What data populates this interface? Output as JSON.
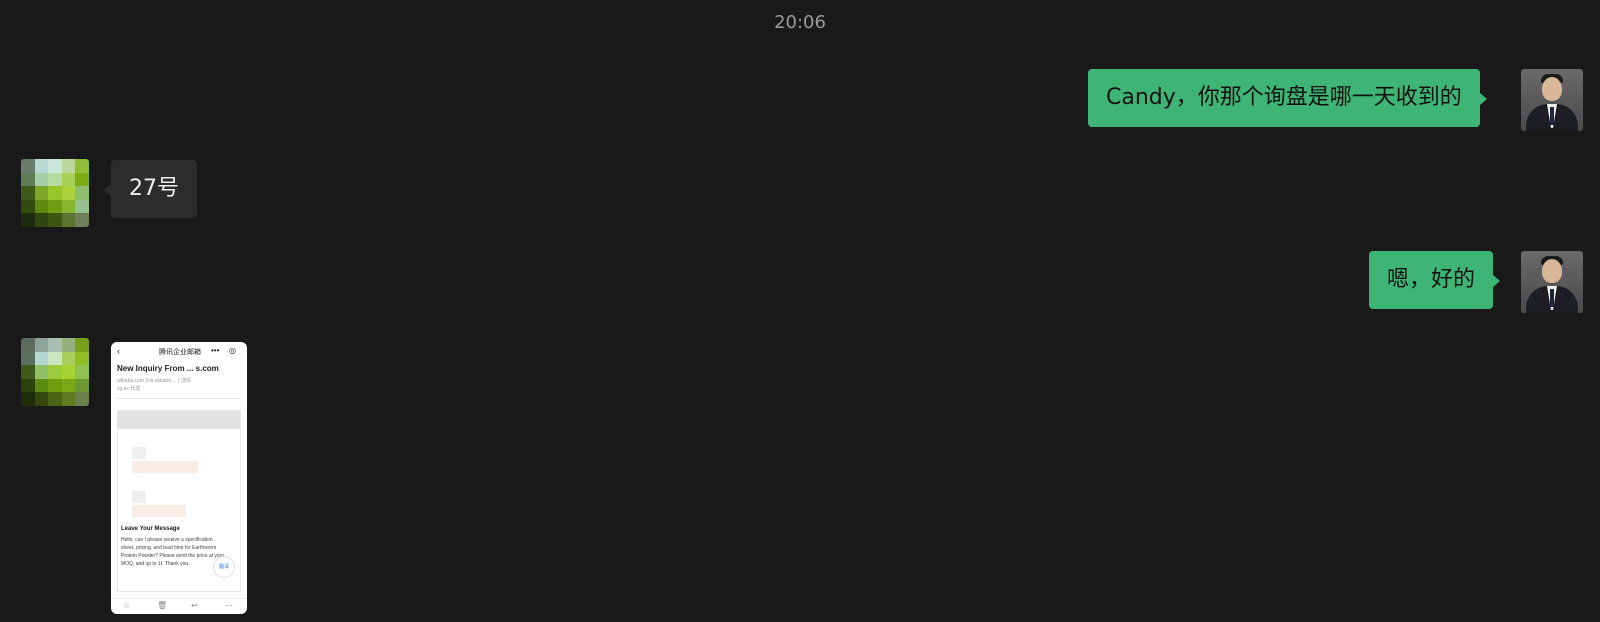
{
  "chat": {
    "timestamp": "20:06",
    "messages": [
      {
        "side": "right",
        "text": "Candy，你那个询盘是哪一天收到的"
      },
      {
        "side": "left",
        "text": "27号"
      },
      {
        "side": "right",
        "text": "嗯，好的"
      },
      {
        "side": "left",
        "type": "image"
      }
    ]
  },
  "image_message": {
    "back_icon": "chevron-left-icon",
    "title": "腾讯企业邮箱",
    "more": "•••",
    "subject": "New Inquiry From ... s.com",
    "sender": "alibaba.com (via alibaba ... ) 详情",
    "sender_line2": "cg.ec 代发",
    "leave_heading": "Leave Your Message",
    "body": "Hello, can I please receive a specification sheet, pricing, and lead time for Earthworm Protein Powder? Please send the price at your MOQ, and up to 1t. Thank you.",
    "translate_label": "翻译",
    "bottom_icons": [
      "star-icon",
      "trash-icon",
      "reply-icon",
      "more-icon"
    ]
  },
  "colors": {
    "background": "#191919",
    "bubble_self": "#3eb575",
    "bubble_other": "#2c2c2c",
    "timestamp": "#9a9a9a"
  }
}
